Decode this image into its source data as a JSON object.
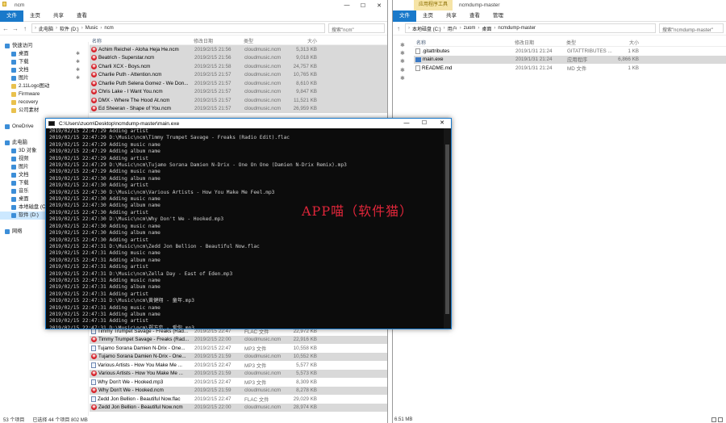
{
  "left_window": {
    "title": "ncm",
    "controls": {
      "min": "—",
      "max": "☐",
      "close": "✕"
    },
    "ribbon_tabs": [
      "文件",
      "主页",
      "共享",
      "查看"
    ],
    "breadcrumb": [
      "此电脑",
      "软件 (D:)",
      "Music",
      "ncm"
    ],
    "search_placeholder": "搜索\"ncm\"",
    "columns": {
      "name": "名称",
      "date": "修改日期",
      "type": "类型",
      "size": "大小"
    },
    "sidebar": [
      {
        "label": "快速访问",
        "icon": "star-icon",
        "pinned": false
      },
      {
        "label": "桌面",
        "icon": "desktop-icon",
        "pinned": true
      },
      {
        "label": "下载",
        "icon": "download-icon",
        "pinned": true
      },
      {
        "label": "文档",
        "icon": "document-icon",
        "pinned": true
      },
      {
        "label": "图片",
        "icon": "picture-icon",
        "pinned": true
      },
      {
        "label": "2.11Logo图动",
        "icon": "folder-icon",
        "pinned": false
      },
      {
        "label": "Firmware",
        "icon": "folder-icon",
        "pinned": false
      },
      {
        "label": "recovery",
        "icon": "folder-icon",
        "pinned": false
      },
      {
        "label": "公司素材",
        "icon": "folder-icon",
        "pinned": false
      },
      {
        "label": "",
        "icon": "",
        "pinned": false
      },
      {
        "label": "OneDrive",
        "icon": "cloud-icon",
        "pinned": false
      },
      {
        "label": "",
        "icon": "",
        "pinned": false
      },
      {
        "label": "此电脑",
        "icon": "computer-icon",
        "pinned": false
      },
      {
        "label": "3D 对象",
        "icon": "cube-icon",
        "pinned": false
      },
      {
        "label": "视频",
        "icon": "video-icon",
        "pinned": false
      },
      {
        "label": "图片",
        "icon": "picture-icon",
        "pinned": false
      },
      {
        "label": "文档",
        "icon": "document-icon",
        "pinned": false
      },
      {
        "label": "下载",
        "icon": "download-icon",
        "pinned": false
      },
      {
        "label": "音乐",
        "icon": "music-icon",
        "pinned": false
      },
      {
        "label": "桌面",
        "icon": "desktop-icon",
        "pinned": false
      },
      {
        "label": "本地磁盘 (C:)",
        "icon": "drive-icon",
        "pinned": false
      },
      {
        "label": "软件 (D:)",
        "icon": "drive-icon",
        "pinned": false
      },
      {
        "label": "",
        "icon": "",
        "pinned": false
      },
      {
        "label": "网络",
        "icon": "network-icon",
        "pinned": false
      }
    ],
    "files_top": [
      {
        "name": "Achim Reichel - Aloha Heja He.ncm",
        "date": "2019/2/15 21:56",
        "type": "cloudmusic.ncm",
        "size": "5,313 KB",
        "kind": "ncm",
        "hl": "alt"
      },
      {
        "name": "Beatrich - Superstar.ncm",
        "date": "2019/2/15 21:56",
        "type": "cloudmusic.ncm",
        "size": "9,018 KB",
        "kind": "ncm",
        "hl": "alt"
      },
      {
        "name": "Charli XCX - Boys.ncm",
        "date": "2019/2/15 21:58",
        "type": "cloudmusic.ncm",
        "size": "24,757 KB",
        "kind": "ncm",
        "hl": "alt"
      },
      {
        "name": "Charlie Puth - Attention.ncm",
        "date": "2019/2/15 21:57",
        "type": "cloudmusic.ncm",
        "size": "10,765 KB",
        "kind": "ncm",
        "hl": "alt"
      },
      {
        "name": "Charlie Puth Selena Gomez - We Don...",
        "date": "2019/2/15 21:57",
        "type": "cloudmusic.ncm",
        "size": "8,610 KB",
        "kind": "ncm",
        "hl": "alt"
      },
      {
        "name": "Chris Lake - I Want You.ncm",
        "date": "2019/2/15 21:57",
        "type": "cloudmusic.ncm",
        "size": "9,847 KB",
        "kind": "ncm",
        "hl": "alt"
      },
      {
        "name": "DMX - Where The Hood At.ncm",
        "date": "2019/2/15 21:57",
        "type": "cloudmusic.ncm",
        "size": "11,521 KB",
        "kind": "ncm",
        "hl": "alt"
      },
      {
        "name": "Ed Sheeran - Shape of You.ncm",
        "date": "2019/2/15 21:57",
        "type": "cloudmusic.ncm",
        "size": "26,959 KB",
        "kind": "ncm",
        "hl": "alt"
      }
    ],
    "files_bottom": [
      {
        "name": "Timmy Trumpet Savage - Freaks (Rad...",
        "date": "2019/2/15 22:47",
        "type": "FLAC 文件",
        "size": "22,972 KB",
        "kind": "flac",
        "hl": ""
      },
      {
        "name": "Timmy Trumpet Savage - Freaks (Rad...",
        "date": "2019/2/15 22:00",
        "type": "cloudmusic.ncm",
        "size": "22,916 KB",
        "kind": "ncm",
        "hl": "alt"
      },
      {
        "name": "Tujamo Sorana Damien N-Drix - One...",
        "date": "2019/2/15 22:47",
        "type": "MP3 文件",
        "size": "10,558 KB",
        "kind": "flac",
        "hl": ""
      },
      {
        "name": "Tujamo Sorana Damien N-Drix - One...",
        "date": "2019/2/15 21:59",
        "type": "cloudmusic.ncm",
        "size": "10,552 KB",
        "kind": "ncm",
        "hl": "alt"
      },
      {
        "name": "Various Artists - How You Make Me ...",
        "date": "2019/2/15 22:47",
        "type": "MP3 文件",
        "size": "5,577 KB",
        "kind": "flac",
        "hl": ""
      },
      {
        "name": "Various Artists - How You Make Me ...",
        "date": "2019/2/15 21:59",
        "type": "cloudmusic.ncm",
        "size": "5,573 KB",
        "kind": "ncm",
        "hl": "alt"
      },
      {
        "name": "Why Don't We - Hooked.mp3",
        "date": "2019/2/15 22:47",
        "type": "MP3 文件",
        "size": "8,309 KB",
        "kind": "flac",
        "hl": ""
      },
      {
        "name": "Why Don't We - Hooked.ncm",
        "date": "2019/2/15 21:59",
        "type": "cloudmusic.ncm",
        "size": "8,278 KB",
        "kind": "ncm",
        "hl": "alt"
      },
      {
        "name": "Zedd Jon Bellion - Beautiful Now.flac",
        "date": "2019/2/15 22:47",
        "type": "FLAC 文件",
        "size": "29,029 KB",
        "kind": "flac",
        "hl": ""
      },
      {
        "name": "Zedd Jon Bellion - Beautiful Now.ncm",
        "date": "2019/2/15 22:00",
        "type": "cloudmusic.ncm",
        "size": "28,974 KB",
        "kind": "ncm",
        "hl": "alt"
      }
    ],
    "status_count": "53 个项目",
    "status_sel": "已选择 44 个项目 802 MB"
  },
  "right_window": {
    "title": "ncmdump-master",
    "context_tab": "应用程序工具",
    "manage_tab": "管理",
    "ribbon_tabs": [
      "文件",
      "主页",
      "共享",
      "查看"
    ],
    "breadcrumb": [
      "本地磁盘 (C:)",
      "用户",
      "zuom",
      "桌面",
      "ncmdump-master"
    ],
    "search_placeholder": "搜索\"ncmdump-master\"",
    "columns": {
      "name": "名称",
      "date": "修改日期",
      "type": "类型",
      "size": "大小"
    },
    "pins": "✱ ✱ ✱ ✱ ✱",
    "files": [
      {
        "name": ".gitattributes",
        "date": "2019/1/31 21:24",
        "type": "GITATTRIBUTES ...",
        "size": "1 KB",
        "kind": "doc",
        "hl": ""
      },
      {
        "name": "main.exe",
        "date": "2019/1/31 21:24",
        "type": "应用程序",
        "size": "6,866 KB",
        "kind": "exe",
        "hl": "alt"
      },
      {
        "name": "README.md",
        "date": "2019/1/31 21:24",
        "type": "MD 文件",
        "size": "1 KB",
        "kind": "doc",
        "hl": ""
      }
    ],
    "status": "6.51 MB"
  },
  "console": {
    "title": "C:\\Users\\zuom\\Desktop\\ncmdump-master\\main.exe",
    "controls": {
      "min": "—",
      "max": "☐",
      "close": "✕"
    },
    "lines": [
      "2019/02/15 22:47:29 Adding artist",
      "2019/02/15 22:47:29 D:\\Music\\ncm\\Timmy Trumpet Savage - Freaks (Radio Edit).flac",
      "2019/02/15 22:47:29 Adding music name",
      "2019/02/15 22:47:29 Adding album name",
      "2019/02/15 22:47:29 Adding artist",
      "2019/02/15 22:47:29 D:\\Music\\ncm\\Tujamo Sorana Damien N-Drix - One On One (Damien N-Drix Remix).mp3",
      "2019/02/15 22:47:29 Adding music name",
      "2019/02/15 22:47:30 Adding album name",
      "2019/02/15 22:47:30 Adding artist",
      "2019/02/15 22:47:30 D:\\Music\\ncm\\Various Artists - How You Make Me Feel.mp3",
      "2019/02/15 22:47:30 Adding music name",
      "2019/02/15 22:47:30 Adding album name",
      "2019/02/15 22:47:30 Adding artist",
      "2019/02/15 22:47:30 D:\\Music\\ncm\\Why Don't We - Hooked.mp3",
      "2019/02/15 22:47:30 Adding music name",
      "2019/02/15 22:47:30 Adding album name",
      "2019/02/15 22:47:30 Adding artist",
      "2019/02/15 22:47:31 D:\\Music\\ncm\\Zedd Jon Bellion - Beautiful Now.flac",
      "2019/02/15 22:47:31 Adding music name",
      "2019/02/15 22:47:31 Adding album name",
      "2019/02/15 22:47:31 Adding artist",
      "2019/02/15 22:47:31 D:\\Music\\ncm\\Zella Day - East of Eden.mp3",
      "2019/02/15 22:47:31 Adding music name",
      "2019/02/15 22:47:31 Adding album name",
      "2019/02/15 22:47:31 Adding artist",
      "2019/02/15 22:47:31 D:\\Music\\ncm\\黄健翔 - 童年.mp3",
      "2019/02/15 22:47:31 Adding music name",
      "2019/02/15 22:47:31 Adding album name",
      "2019/02/15 22:47:31 Adding artist",
      "2019/02/15 22:47:31 D:\\Music\\ncm\\郑方恋 - 爱你.mp3"
    ]
  },
  "watermark": "APP喵（软件猫）"
}
